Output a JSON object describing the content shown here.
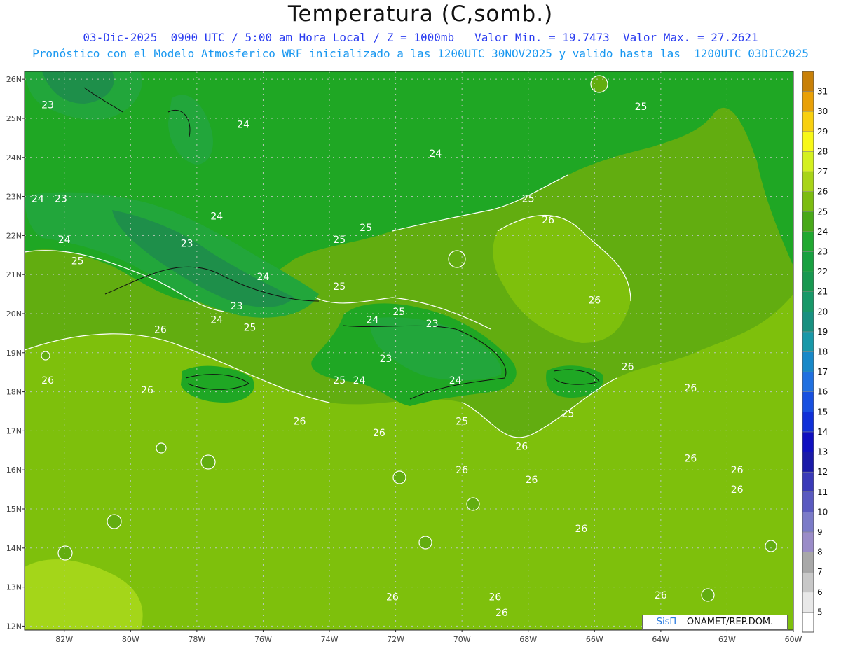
{
  "header": {
    "title": "Temperatura (C,somb.)",
    "line1": "03-Dic-2025  0900 UTC / 5:00 am Hora Local / Z = 1000mb   Valor Min. = 19.7473  Valor Max. = 27.2621",
    "line2": "Pronóstico con el Modelo Atmosferico WRF inicializado a las 1200UTC_30NOV2025 y valido hasta las  1200UTC_03DIC2025"
  },
  "map": {
    "lat_labels": [
      "26N",
      "25N",
      "24N",
      "23N",
      "22N",
      "21N",
      "20N",
      "19N",
      "18N",
      "17N",
      "16N",
      "15N",
      "14N",
      "13N",
      "12N"
    ],
    "lon_labels": [
      "82W",
      "80W",
      "78W",
      "76W",
      "74W",
      "72W",
      "70W",
      "68W",
      "66W",
      "64W",
      "62W",
      "60W"
    ],
    "contour_labels": [
      {
        "text": "23",
        "lon": -82.5,
        "lat": 25.35
      },
      {
        "text": "24",
        "lon": -76.6,
        "lat": 24.85
      },
      {
        "text": "24",
        "lon": -70.8,
        "lat": 24.1
      },
      {
        "text": "25",
        "lon": -64.6,
        "lat": 25.3
      },
      {
        "text": "24",
        "lon": -82.8,
        "lat": 22.95
      },
      {
        "text": "23",
        "lon": -82.1,
        "lat": 22.95
      },
      {
        "text": "24",
        "lon": -77.4,
        "lat": 22.5
      },
      {
        "text": "24",
        "lon": -82.0,
        "lat": 21.9
      },
      {
        "text": "23",
        "lon": -78.3,
        "lat": 21.8
      },
      {
        "text": "25",
        "lon": -81.6,
        "lat": 21.35
      },
      {
        "text": "25",
        "lon": -73.7,
        "lat": 21.9
      },
      {
        "text": "25",
        "lon": -72.9,
        "lat": 22.2
      },
      {
        "text": "24",
        "lon": -76.0,
        "lat": 20.95
      },
      {
        "text": "25",
        "lon": -73.7,
        "lat": 20.7
      },
      {
        "text": "25",
        "lon": -68.0,
        "lat": 22.95
      },
      {
        "text": "26",
        "lon": -67.4,
        "lat": 22.4
      },
      {
        "text": "23",
        "lon": -76.8,
        "lat": 20.2
      },
      {
        "text": "24",
        "lon": -77.4,
        "lat": 19.85
      },
      {
        "text": "25",
        "lon": -76.4,
        "lat": 19.65
      },
      {
        "text": "26",
        "lon": -79.1,
        "lat": 19.6
      },
      {
        "text": "24",
        "lon": -72.7,
        "lat": 19.85
      },
      {
        "text": "25",
        "lon": -71.9,
        "lat": 20.05
      },
      {
        "text": "23",
        "lon": -70.9,
        "lat": 19.75
      },
      {
        "text": "23",
        "lon": -72.3,
        "lat": 18.85
      },
      {
        "text": "26",
        "lon": -66.0,
        "lat": 20.35
      },
      {
        "text": "25",
        "lon": -73.7,
        "lat": 18.3
      },
      {
        "text": "24",
        "lon": -73.1,
        "lat": 18.3
      },
      {
        "text": "24",
        "lon": -70.2,
        "lat": 18.3
      },
      {
        "text": "26",
        "lon": -65.0,
        "lat": 18.65
      },
      {
        "text": "26",
        "lon": -82.5,
        "lat": 18.3
      },
      {
        "text": "26",
        "lon": -79.5,
        "lat": 18.05
      },
      {
        "text": "26",
        "lon": -63.1,
        "lat": 18.1
      },
      {
        "text": "25",
        "lon": -66.8,
        "lat": 17.45
      },
      {
        "text": "25",
        "lon": -70.0,
        "lat": 17.25
      },
      {
        "text": "26",
        "lon": -74.9,
        "lat": 17.25
      },
      {
        "text": "26",
        "lon": -72.5,
        "lat": 16.95
      },
      {
        "text": "26",
        "lon": -68.2,
        "lat": 16.6
      },
      {
        "text": "26",
        "lon": -63.1,
        "lat": 16.3
      },
      {
        "text": "26",
        "lon": -70.0,
        "lat": 16.0
      },
      {
        "text": "26",
        "lon": -67.9,
        "lat": 15.75
      },
      {
        "text": "26",
        "lon": -61.7,
        "lat": 16.0
      },
      {
        "text": "26",
        "lon": -61.7,
        "lat": 15.5
      },
      {
        "text": "26",
        "lon": -66.4,
        "lat": 14.5
      },
      {
        "text": "26",
        "lon": -72.1,
        "lat": 12.75
      },
      {
        "text": "26",
        "lon": -69.0,
        "lat": 12.75
      },
      {
        "text": "26",
        "lon": -68.8,
        "lat": 12.35
      },
      {
        "text": "26",
        "lon": -64.0,
        "lat": 12.8
      }
    ]
  },
  "colorbar": {
    "labels": [
      "5",
      "6",
      "7",
      "8",
      "9",
      "10",
      "11",
      "12",
      "13",
      "14",
      "15",
      "16",
      "17",
      "18",
      "19",
      "20",
      "21",
      "22",
      "23",
      "24",
      "25",
      "26",
      "27",
      "28",
      "29",
      "30",
      "31"
    ],
    "colors": [
      "#ffffff",
      "#e8e8e8",
      "#c8c8c8",
      "#a8a8a8",
      "#9a8cc8",
      "#7b7bc8",
      "#5a5ac0",
      "#3a3ab8",
      "#1a1aa8",
      "#1010c0",
      "#1030d8",
      "#1850e0",
      "#2070e0",
      "#1888c8",
      "#1898a8",
      "#189080",
      "#189868",
      "#189850",
      "#18a040",
      "#20a830",
      "#48a818",
      "#7cbc10",
      "#a8d418",
      "#d4f020",
      "#f8f818",
      "#f8d010",
      "#e8a008",
      "#c88008"
    ]
  },
  "credit": {
    "brand": "SisΠ",
    "text": "– ONAMET/REP.DOM."
  },
  "colors": {
    "t22": "#1e8f4a",
    "t23": "#22a63b",
    "t24": "#1fa724",
    "t25": "#62ad10",
    "t26": "#7ec00c",
    "t27": "#a4d619"
  }
}
